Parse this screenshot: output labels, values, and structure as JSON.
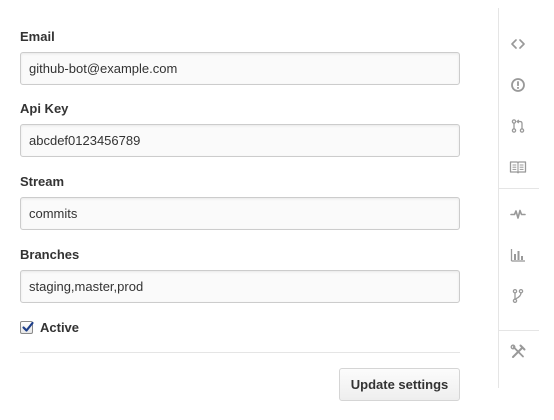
{
  "form": {
    "fields": [
      {
        "label": "Email",
        "value": "github-bot@example.com"
      },
      {
        "label": "Api Key",
        "value": "abcdef0123456789"
      },
      {
        "label": "Stream",
        "value": "commits"
      },
      {
        "label": "Branches",
        "value": "staging,master,prod"
      }
    ],
    "active": {
      "label": "Active",
      "checked": true
    },
    "submit_label": "Update settings"
  },
  "sidebar": {
    "icons": [
      "code-icon",
      "issue-icon",
      "pull-request-icon",
      "wiki-icon",
      "pulse-icon",
      "graphs-icon",
      "network-icon",
      "settings-tools-icon"
    ]
  },
  "colors": {
    "icon": "#999999",
    "input_border": "#cccccc",
    "checkbox_check": "#1e3f8a"
  }
}
